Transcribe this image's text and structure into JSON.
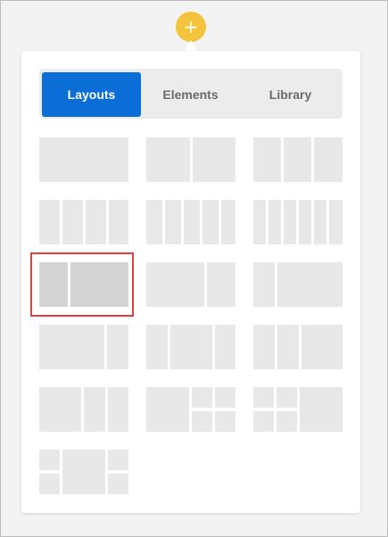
{
  "add_button": {
    "label": "+"
  },
  "tabs": [
    {
      "label": "Layouts",
      "active": true
    },
    {
      "label": "Elements",
      "active": false
    },
    {
      "label": "Library",
      "active": false
    }
  ],
  "layout_options": [
    {
      "name": "layout-1",
      "rows": [
        [
          1
        ]
      ]
    },
    {
      "name": "layout-1-1",
      "rows": [
        [
          1,
          1
        ]
      ]
    },
    {
      "name": "layout-1-1-1",
      "rows": [
        [
          1,
          1,
          1
        ]
      ]
    },
    {
      "name": "layout-1-1-1-1",
      "rows": [
        [
          1,
          1,
          1,
          1
        ]
      ]
    },
    {
      "name": "layout-1-1-1-1-1",
      "rows": [
        [
          1,
          1,
          1,
          1,
          1
        ]
      ]
    },
    {
      "name": "layout-1-1-1-1-1-1",
      "rows": [
        [
          1,
          1,
          1,
          1,
          1,
          1
        ]
      ]
    },
    {
      "name": "layout-1-2",
      "rows": [
        [
          1,
          2
        ]
      ],
      "selected": true
    },
    {
      "name": "layout-2-1",
      "rows": [
        [
          2,
          1
        ]
      ]
    },
    {
      "name": "layout-1-3",
      "rows": [
        [
          1,
          3
        ]
      ]
    },
    {
      "name": "layout-3-1",
      "rows": [
        [
          3,
          1
        ]
      ]
    },
    {
      "name": "layout-1-2-1",
      "rows": [
        [
          1,
          2,
          1
        ]
      ]
    },
    {
      "name": "layout-1-1-2",
      "rows": [
        [
          1,
          1,
          2
        ]
      ]
    },
    {
      "name": "layout-2-1-1",
      "rows": [
        [
          2,
          1,
          1
        ]
      ]
    },
    {
      "name": "layout-2-stack",
      "special": "left-big-right-grid"
    },
    {
      "name": "layout-stack-2",
      "special": "left-grid-right-big"
    },
    {
      "name": "layout-stack-2-stack",
      "special": "side-grids-center-big"
    }
  ]
}
